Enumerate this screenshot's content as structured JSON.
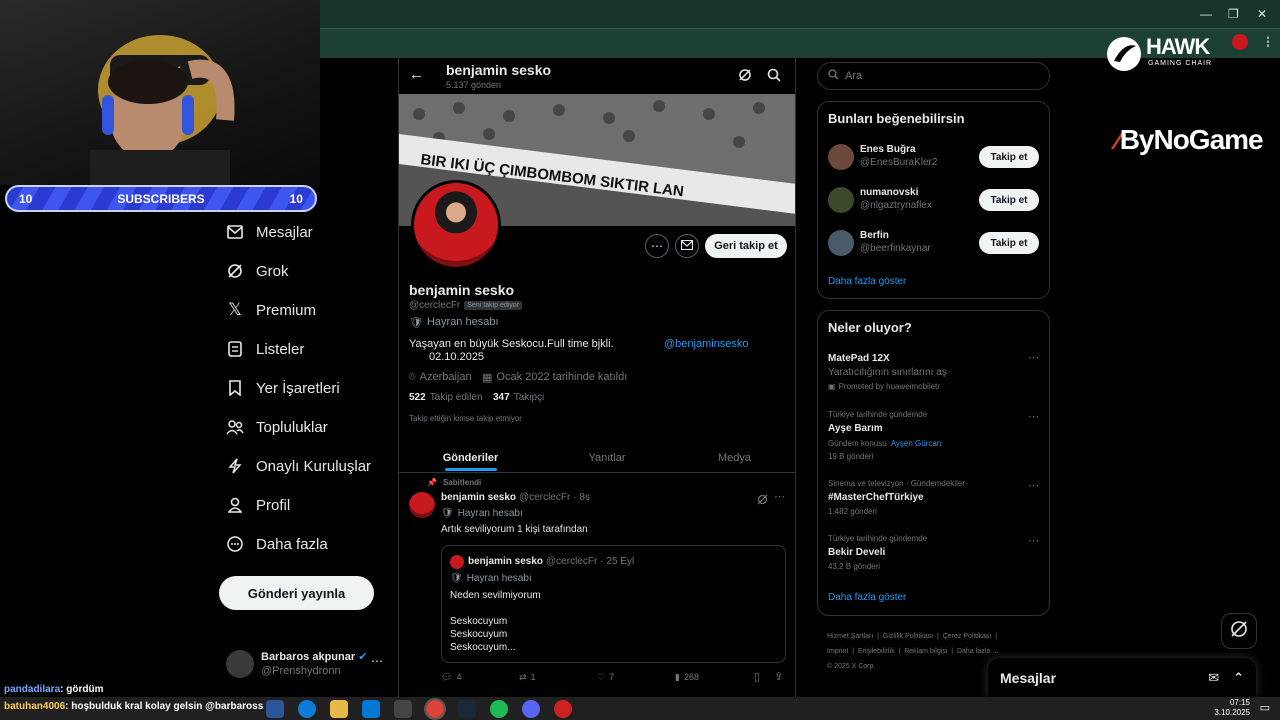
{
  "window": {
    "minimize": "—",
    "maximize": "❐",
    "close": "✕"
  },
  "stream": {
    "subs_left": "10",
    "subs_label": "SUBSCRIBERS",
    "subs_right": "10",
    "hawk_title": "HAWK",
    "hawk_sub": "GAMING CHAIR",
    "bynogame": "ByNoGame",
    "chat": [
      {
        "user": "pandadilara",
        "text": ": gördüm"
      },
      {
        "user": "batuhan4006",
        "text": ": hoşbulduk kral kolay gelsin @barbaross"
      }
    ]
  },
  "nav": {
    "items": [
      {
        "label": "Mesajlar",
        "icon": "mail-icon"
      },
      {
        "label": "Grok",
        "icon": "grok-icon"
      },
      {
        "label": "Premium",
        "icon": "x-logo-icon"
      },
      {
        "label": "Listeler",
        "icon": "list-icon"
      },
      {
        "label": "Yer İşaretleri",
        "icon": "bookmark-icon"
      },
      {
        "label": "Topluluklar",
        "icon": "communities-icon"
      },
      {
        "label": "Onaylı Kuruluşlar",
        "icon": "lightning-icon"
      },
      {
        "label": "Profil",
        "icon": "profile-icon"
      },
      {
        "label": "Daha fazla",
        "icon": "more-circle-icon"
      }
    ],
    "post_button": "Gönderi yayınla",
    "account": {
      "name": "Barbaros akpunar",
      "handle": "@Prenshydronn"
    }
  },
  "profile": {
    "header_name": "benjamin sesko",
    "post_count": "5.137 gönderi",
    "name": "benjamin sesko",
    "handle": "@cerclecFr",
    "follows_you": "Seni takip ediyor",
    "fan_label": "Hayran hesabı",
    "bio": "Yaşayan en büyük Seskocu.Full time bjkli.",
    "bio_date": "02.10.2025",
    "bio_mention": "@benjaminsesko",
    "location": "Azerbaijan",
    "joined": "Ocak 2022 tarihinde katıldı",
    "following_count": "522",
    "following_label": "Takip edilen",
    "followers_count": "347",
    "followers_label": "Takipçi",
    "mutuals": "Takip ettiğin kimse takip etmiyor",
    "follow_back": "Geri takip et",
    "banner_text": "BIR IKI ÜÇ   ÇIMBOMBOM   SIKTIR LAN"
  },
  "tabs": [
    "Gönderiler",
    "Yanıtlar",
    "Medya"
  ],
  "post": {
    "pinned": "Sabitlendi",
    "name": "benjamin sesko",
    "handle": "@cerclecFr",
    "time": "· 8s",
    "fan_label": "Hayran hesabı",
    "text": "Artık seviliyorum 1 kişi tarafından",
    "quote": {
      "name": "benjamin sesko",
      "handle": "@cerclecFr",
      "time": "· 25 Eyl",
      "fan_label": "Hayran hesabı",
      "text": "Neden sevilmiyorum",
      "lines": [
        "Seskocuyum",
        "Seskocuyum",
        "Seskocuyum..."
      ]
    },
    "stats": {
      "replies": "4",
      "reposts": "1",
      "likes": "7",
      "views": "268"
    }
  },
  "sidebar": {
    "search_placeholder": "Ara",
    "who_title": "Bunları beğenebilirsin",
    "suggestions": [
      {
        "name": "Enes Buğra",
        "handle": "@EnesBuraKler2",
        "button": "Takip et",
        "color": "#6b4a3a"
      },
      {
        "name": "numanovski",
        "handle": "@nlgaztrynaflex",
        "button": "Takip et",
        "color": "#3c4a2a"
      },
      {
        "name": "Berfin",
        "handle": "@beerfinkaynar",
        "button": "Takip et",
        "color": "#4a5a6a"
      }
    ],
    "who_more": "Daha fazla göster",
    "trends_title": "Neler oluyor?",
    "trends": [
      {
        "context": "",
        "title": "MatePad 12X",
        "sub": "Yaratıcılığının sınırlarını aş",
        "meta": "Promoted by huaweimobiletr"
      },
      {
        "context": "Türkiye tarihinde gündemde",
        "title": "Ayşe Barım",
        "sub": "Gündem konusu",
        "sub_link": "Ayşen Gürcan",
        "meta": "19 B gönderi"
      },
      {
        "context": "Sinema ve televizyon · Gündemdekiler",
        "title": "#MasterChefTürkiye",
        "sub": "",
        "meta": "1.482 gönderi"
      },
      {
        "context": "Türkiye tarihinde gündemde",
        "title": "Bekir Develi",
        "sub": "",
        "meta": "43,2 B gönderi"
      }
    ],
    "trends_more": "Daha fazla göster",
    "footer": [
      "Hizmet Şartları",
      "Gizlilik Politikası",
      "Çerez Politikası",
      "Imprint",
      "Erişilebilirlik",
      "Reklam bilgisi",
      "Daha fazla ...",
      "© 2025 X Corp."
    ]
  },
  "messages_drawer": {
    "title": "Mesajlar"
  },
  "taskbar": {
    "time": "07:15",
    "date": "3.10.2025"
  }
}
